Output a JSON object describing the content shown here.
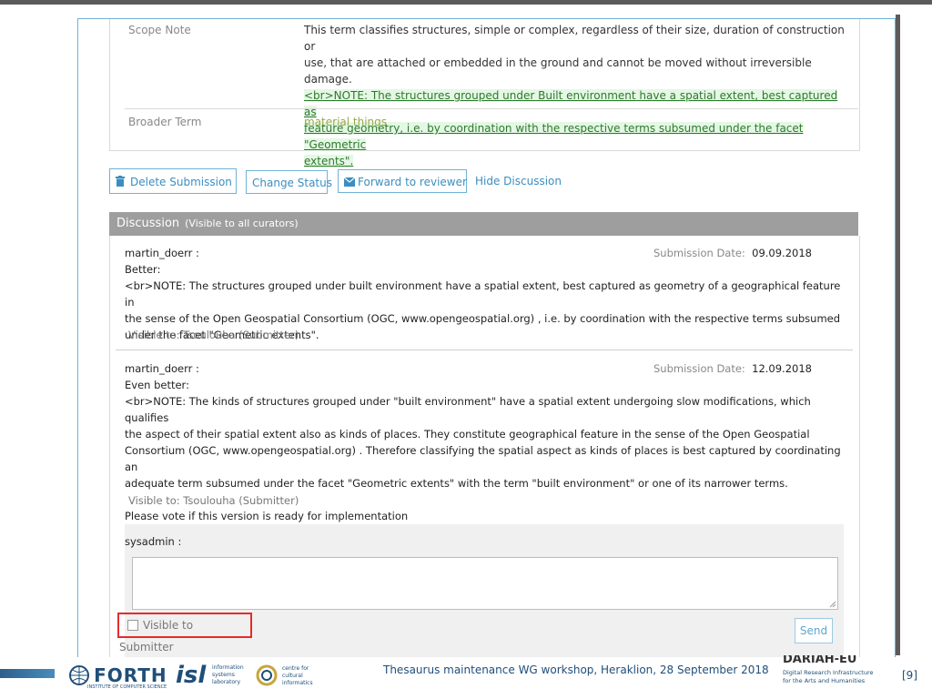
{
  "properties": {
    "scope_note_label": "Scope Note",
    "scope_note_line1": "This term classifies structures, simple or complex, regardless of their size, duration of construction or",
    "scope_note_line2": "use, that are attached or embedded in the ground and cannot be moved without irreversible damage.",
    "scope_note_link_line1": "<br>NOTE: The structures grouped under Built environment have a spatial extent, best captured as",
    "scope_note_link_line2": "feature geometry, i.e. by coordination with the respective terms subsumed under the facet \"Geometric",
    "scope_note_link_line3": "extents\".",
    "broader_term_label": "Broader Term",
    "broader_term_value": "material things"
  },
  "actions": {
    "delete": "Delete Submission",
    "change_status": "Change Status",
    "forward": "Forward to reviewer",
    "hide_discussion": "Hide Discussion"
  },
  "discussion": {
    "title": "Discussion",
    "subtitle": "(Visible to all curators)",
    "date_label": "Submission Date:",
    "comments": [
      {
        "author": "martin_doerr :",
        "date": "09.09.2018",
        "lines": [
          "Better:",
          "<br>NOTE: The structures grouped under built environment have a spatial extent, best captured as geometry of a geographical feature in",
          "the sense of the Open Geospatial Consortium (OGC, www.opengeospatial.org) , i.e. by coordination with the respective terms subsumed",
          "under the facet \"Geometric extents\"."
        ],
        "visible_to": "Visible to: Tsoulouha (Submitter)"
      },
      {
        "author": "martin_doerr :",
        "date": "12.09.2018",
        "lines": [
          "Even better:",
          "<br>NOTE: The kinds of structures grouped under \"built environment\" have a spatial extent undergoing slow modifications, which qualifies",
          "the aspect of their spatial extent also as kinds of places. They constitute geographical feature in the sense of the Open Geospatial",
          "Consortium (OGC, www.opengeospatial.org) . Therefore classifying the spatial aspect as kinds of places is best captured by coordinating an",
          "adequate term subsumed under the facet \"Geometric extents\" with the term \"built environment\" or one of its narrower terms.",
          "",
          "Please vote if this version is ready for implementation"
        ],
        "visible_to": "Visible to: Tsoulouha (Submitter)"
      }
    ],
    "reply": {
      "author": "sysadmin :",
      "textarea_value": "",
      "visible_label": "Visible to Submitter",
      "send_label": "Send"
    }
  },
  "footer": {
    "caption": "Thesaurus maintenance WG workshop, Heraklion, 28 September 2018",
    "page": "[9]",
    "logo_forth": "FORTH",
    "logo_forth_sub": "INSTITUTE OF COMPUTER SCIENCE",
    "logo_isl": "isl",
    "logo_isl_text": "information systems laboratory",
    "logo_ccci_text": "centre for cultural informatics",
    "dariah_name": "DARIAH-EU",
    "dariah_sub1": "Digital Research Infrastructure",
    "dariah_sub2": "for the Arts and Humanities"
  },
  "colors": {
    "accent": "#3b8ec0",
    "discussion_header": "#9e9e9e",
    "highlight_box": "#e52b2b",
    "note_bg": "#e5f7e5",
    "note_text": "#2c7a2c"
  }
}
